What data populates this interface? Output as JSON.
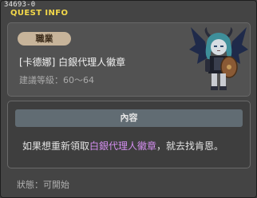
{
  "quest": {
    "id": "34693-0",
    "title": "QUEST INFO",
    "job_label": "職業",
    "name": "[卡德娜] 白銀代理人徽章",
    "recommended_level": "建議等級：60～64"
  },
  "content": {
    "header": "內容",
    "text_before": "如果想重新領取",
    "text_highlight": "白銀代理人徽章",
    "text_after": "，就去找肯恩。"
  },
  "status": "狀態：可開始",
  "colors": {
    "title": "#f3d84a",
    "highlight": "#d48ef0",
    "badge": "#c7b49a",
    "content_header": "#616c73"
  },
  "icons": {
    "character": "npc-character-portrait"
  }
}
